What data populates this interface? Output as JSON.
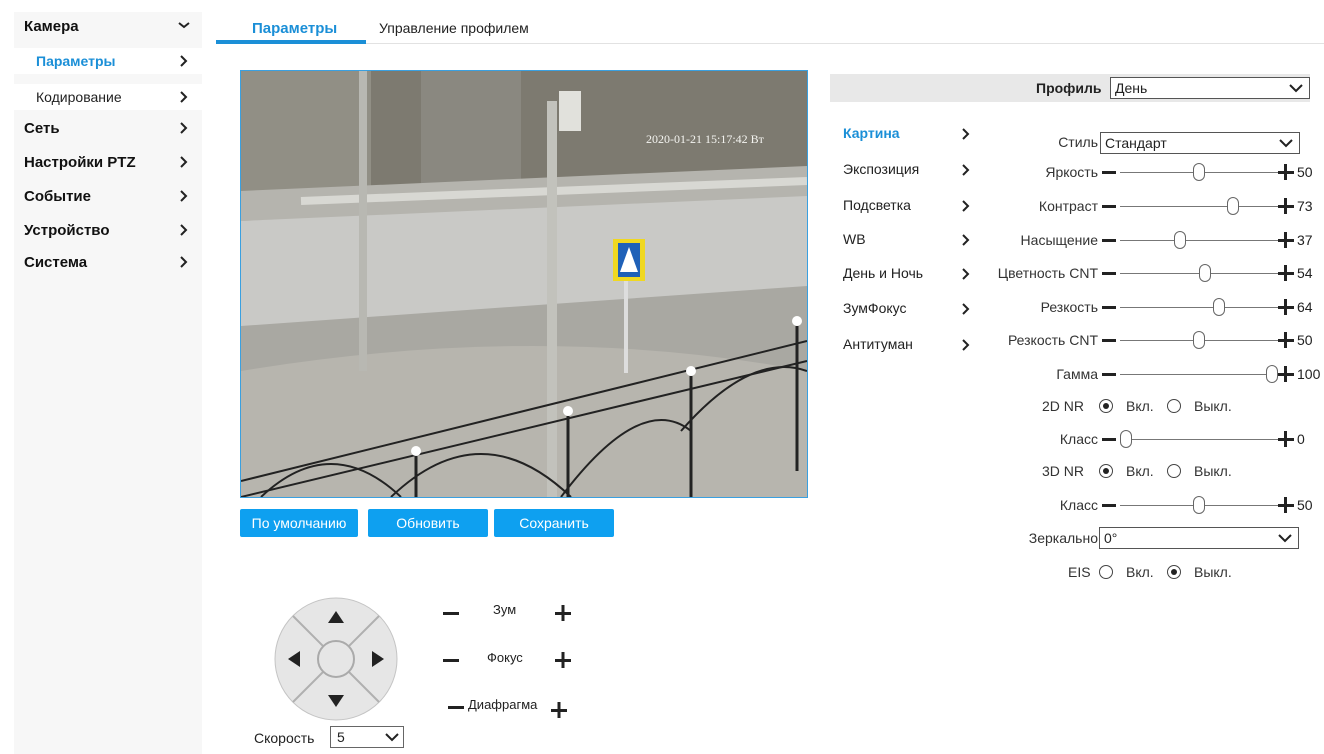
{
  "sidebar": {
    "items": [
      {
        "label": "Камера",
        "chevron": "chevron-down-icon"
      },
      {
        "label": "Параметры",
        "chevron": "chevron-right-icon"
      },
      {
        "label": "Кодирование",
        "chevron": "chevron-right-icon"
      },
      {
        "label": "Сеть",
        "chevron": "chevron-right-icon"
      },
      {
        "label": "Настройки PTZ",
        "chevron": "chevron-right-icon"
      },
      {
        "label": "Событие",
        "chevron": "chevron-right-icon"
      },
      {
        "label": "Устройство",
        "chevron": "chevron-right-icon"
      },
      {
        "label": "Система",
        "chevron": "chevron-right-icon"
      }
    ]
  },
  "tabs": [
    {
      "label": "Параметры",
      "active": true
    },
    {
      "label": "Управление профилем",
      "active": false
    }
  ],
  "video": {
    "timestamp": "2020-01-21 15:17:42 Вт"
  },
  "buttons": {
    "default": "По умолчанию",
    "refresh": "Обновить",
    "save": "Сохранить"
  },
  "ptz": {
    "zoom": "Зум",
    "focus": "Фокус",
    "iris": "Диафрагма",
    "speed_label": "Скорость",
    "speed_value": "5"
  },
  "profile": {
    "label": "Профиль",
    "value": "День"
  },
  "categories": [
    {
      "label": "Картина",
      "active": true
    },
    {
      "label": "Экспозиция"
    },
    {
      "label": "Подсветка"
    },
    {
      "label": "WB"
    },
    {
      "label": "День и Ночь"
    },
    {
      "label": "ЗумФокус"
    },
    {
      "label": "Антитуман"
    }
  ],
  "style": {
    "label": "Стиль",
    "value": "Стандарт"
  },
  "sliders": [
    {
      "label": "Яркость",
      "value": 50
    },
    {
      "label": "Контраст",
      "value": 73
    },
    {
      "label": "Насыщение",
      "value": 37
    },
    {
      "label": "Цветность CNT",
      "value": 54
    },
    {
      "label": "Резкость",
      "value": 64
    },
    {
      "label": "Резкость CNT",
      "value": 50
    },
    {
      "label": "Гамма",
      "value": 100
    }
  ],
  "nr2d": {
    "label": "2D NR",
    "on": "Вкл.",
    "off": "Выкл.",
    "selected": "on",
    "class_label": "Класс",
    "class_value": 0
  },
  "nr3d": {
    "label": "3D NR",
    "on": "Вкл.",
    "off": "Выкл.",
    "selected": "on",
    "class_label": "Класс",
    "class_value": 50
  },
  "mirror": {
    "label": "Зеркально",
    "value": "0°"
  },
  "eis": {
    "label": "EIS",
    "on": "Вкл.",
    "off": "Выкл.",
    "selected": "off"
  },
  "colors": {
    "accent": "#1b8fd7",
    "button": "#0ea0f0"
  }
}
